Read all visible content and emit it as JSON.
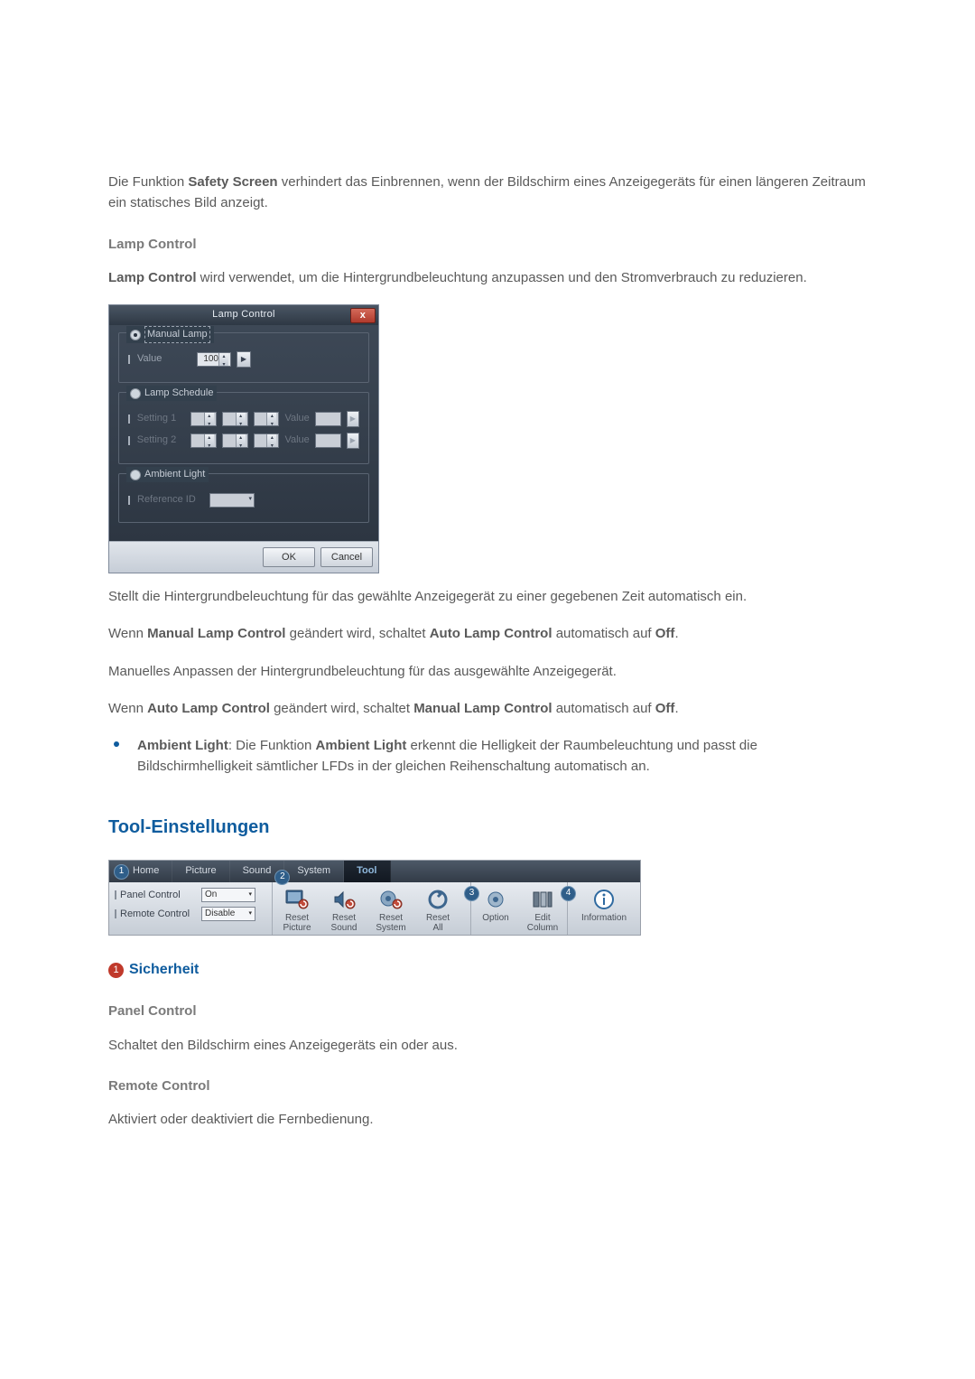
{
  "intro": {
    "p1_pre": "Die Funktion ",
    "p1_b": "Safety Screen",
    "p1_post": " verhindert das Einbrennen, wenn der Bildschirm eines Anzeigegeräts für einen längeren Zeitraum ein statisches Bild anzeigt."
  },
  "lamp_section_title": "Lamp Control",
  "lamp_section_para_b": "Lamp Control",
  "lamp_section_para_post": " wird verwendet, um die Hintergrundbeleuchtung anzupassen und den Stromverbrauch zu reduzieren.",
  "dlg": {
    "title": "Lamp Control",
    "close": "x",
    "manual": {
      "legend": "Manual Lamp",
      "value_label": "Value",
      "value": "100"
    },
    "schedule": {
      "legend": "Lamp Schedule",
      "row1_label": "Setting 1",
      "row1_valuelbl": "Value",
      "row2_label": "Setting 2",
      "row2_valuelbl": "Value"
    },
    "ambient": {
      "legend": "Ambient Light",
      "ref_label": "Reference ID"
    },
    "ok": "OK",
    "cancel": "Cancel"
  },
  "after_dlg_p1": "Stellt die Hintergrundbeleuchtung für das gewählte Anzeigegerät zu einer gegebenen Zeit automatisch ein.",
  "after_dlg_p2": {
    "pre": "Wenn ",
    "b1": "Manual Lamp Control",
    "mid": " geändert wird, schaltet ",
    "b2": "Auto Lamp Control",
    "mid2": " automatisch auf ",
    "b3": "Off",
    "post": "."
  },
  "after_dlg_p3": "Manuelles Anpassen der Hintergrundbeleuchtung für das ausgewählte Anzeigegerät.",
  "after_dlg_p4": {
    "pre": "Wenn ",
    "b1": "Auto Lamp Control",
    "mid": " geändert wird, schaltet ",
    "b2": "Manual Lamp Control",
    "mid2": " automatisch auf ",
    "b3": "Off",
    "post": "."
  },
  "ambient_bullet": {
    "b1": "Ambient Light",
    "pre2": ": Die Funktion ",
    "b2": "Ambient Light",
    "rest": " erkennt die Helligkeit der Raumbeleuchtung und passt die Bildschirmhelligkeit sämtlicher LFDs in der gleichen Reihenschaltung automatisch an."
  },
  "tool_title": "Tool-Einstellungen",
  "ribbon": {
    "tabs": {
      "home": "Home",
      "picture": "Picture",
      "sound": "Sound",
      "system": "System",
      "tool": "Tool"
    },
    "nums": {
      "n1": "1",
      "n2": "2",
      "n3": "3",
      "n4": "4"
    },
    "panel_control_label": "Panel Control",
    "panel_control_value": "On",
    "remote_control_label": "Remote Control",
    "remote_control_value": "Disable",
    "icons": {
      "reset_picture_l1": "Reset",
      "reset_picture_l2": "Picture",
      "reset_sound_l1": "Reset",
      "reset_sound_l2": "Sound",
      "reset_system_l1": "Reset",
      "reset_system_l2": "System",
      "reset_all_l1": "Reset",
      "reset_all_l2": "All",
      "option": "Option",
      "edit_l1": "Edit",
      "edit_l2": "Column",
      "info": "Information"
    }
  },
  "sec_num": "1",
  "sec_title": "Sicherheit",
  "sec_panel_head": "Panel Control",
  "sec_panel_text": "Schaltet den Bildschirm eines Anzeigegeräts ein oder aus.",
  "sec_remote_head": "Remote Control",
  "sec_remote_text": "Aktiviert oder deaktiviert die Fernbedienung."
}
